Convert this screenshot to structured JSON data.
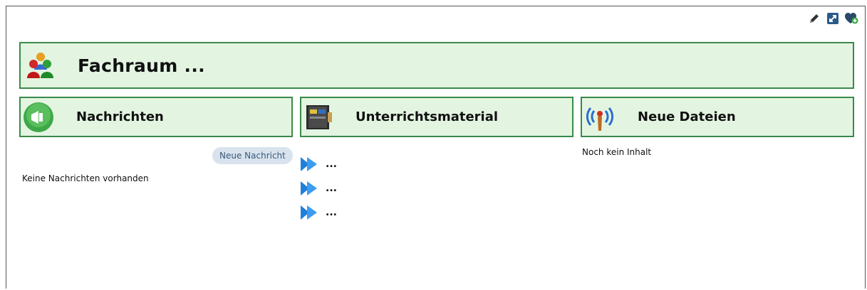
{
  "page": {
    "title": "Fachraum ...",
    "toolbar_icons": [
      "pencil-icon",
      "expand-icon",
      "heart-add-icon"
    ]
  },
  "sections": {
    "nachrichten": {
      "heading": "Nachrichten",
      "new_button": "Neue Nachricht",
      "empty_text": "Keine Nachrichten vorhanden"
    },
    "material": {
      "heading": "Unterrichtsmaterial",
      "items": [
        "...",
        "...",
        "..."
      ]
    },
    "dateien": {
      "heading": "Neue Dateien",
      "empty_text": "Noch kein Inhalt"
    }
  },
  "colors": {
    "header_bg": "#e3f5e1",
    "header_border": "#3a8a4a",
    "button_bg": "#d8e3ee",
    "arrow": "#1f7fd9"
  }
}
